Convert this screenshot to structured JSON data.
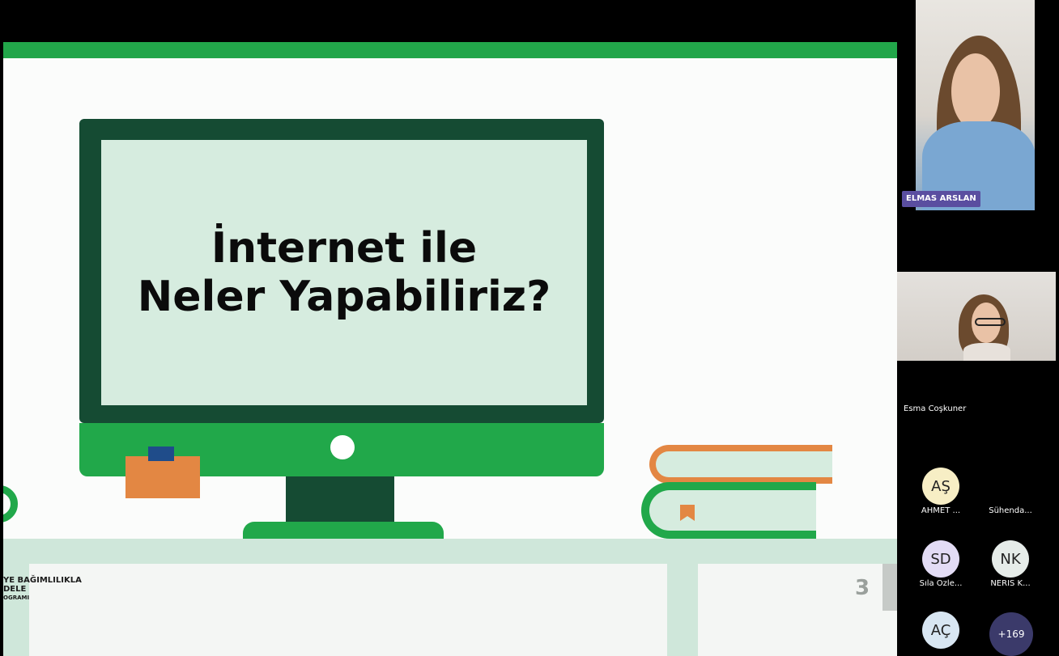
{
  "slide": {
    "title_line1": "İnternet ile",
    "title_line2": "Neler Yapabiliriz?",
    "footer_line1": "YE BAĞIMLILIKLA",
    "footer_line2": "DELE",
    "footer_line3": "OGRAMI",
    "page_number": "3",
    "colors": {
      "green": "#21a84a",
      "dark_green": "#154b33",
      "mint": "#d6ecdf",
      "orange": "#e38743",
      "blue": "#1f4c8a"
    }
  },
  "meeting": {
    "video_tiles": [
      {
        "name": "ELMAS ARSLAN"
      },
      {
        "name": "Esma Coşkuner"
      }
    ],
    "participants": [
      {
        "initials": "AŞ",
        "name": "AHMET ...",
        "color": "#f7eec5"
      },
      {
        "initials": "",
        "name": "Sühenda...",
        "color": ""
      },
      {
        "initials": "SD",
        "name": "Sıla Özle...",
        "color": "#e3dcf5"
      },
      {
        "initials": "NK",
        "name": "NERİS K...",
        "color": "#e6ece9"
      },
      {
        "initials": "AÇ",
        "name": "",
        "color": "#d8e6f2"
      }
    ],
    "more_count": "+169"
  }
}
